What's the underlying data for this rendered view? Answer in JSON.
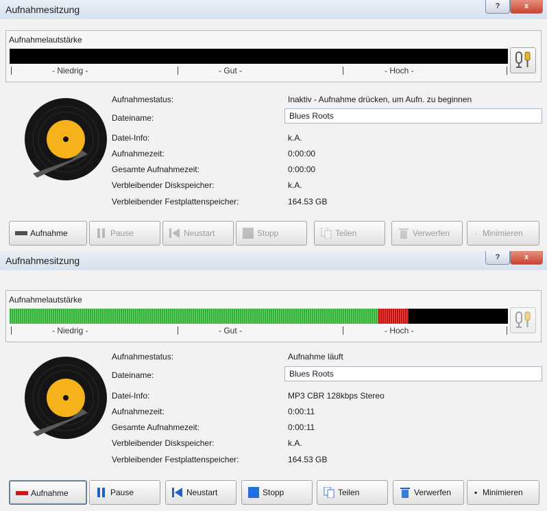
{
  "window_title": "Aufnahmesitzung",
  "help_glyph": "?",
  "close_glyph": "x",
  "volume_label": "Aufnahmelautstärke",
  "scale": {
    "low": "- Niedrig -",
    "good": "- Gut -",
    "high": "- Hoch -"
  },
  "labels": {
    "status": "Aufnahmestatus:",
    "filename": "Dateiname:",
    "fileinfo": "Datei-Info:",
    "rectime": "Aufnahmezeit:",
    "totaltime": "Gesamte Aufnahmezeit:",
    "diskspace": "Verbleibender Diskspeicher:",
    "hdspace": "Verbleibender Festplattenspeicher:"
  },
  "buttons": {
    "record": "Aufnahme",
    "pause": "Pause",
    "restart": "Neustart",
    "stop": "Stopp",
    "split": "Teilen",
    "discard": "Verwerfen",
    "minimize": "Minimieren"
  },
  "sessions": [
    {
      "state": "idle",
      "meter_level": 0.0,
      "status": "Inaktiv - Aufnahme drücken, um Aufn. zu beginnen",
      "filename": "Blues Roots",
      "fileinfo": "k.A.",
      "rectime": "0:00:00",
      "totaltime": "0:00:00",
      "diskspace": "k.A.",
      "hdspace": "164.53 GB"
    },
    {
      "state": "recording",
      "meter_level": 0.74,
      "meter_peak_start": 0.74,
      "meter_peak_end": 0.8,
      "status": "Aufnahme läuft",
      "filename": "Blues Roots",
      "fileinfo": "MP3 CBR 128kbps Stereo",
      "rectime": "0:00:11",
      "totaltime": "0:00:11",
      "diskspace": "k.A.",
      "hdspace": "164.53 GB"
    }
  ],
  "colors": {
    "meter_green": "#2faf38",
    "meter_red": "#c01010",
    "record_red": "#d01818",
    "disc_orange": "#f6b21a"
  }
}
